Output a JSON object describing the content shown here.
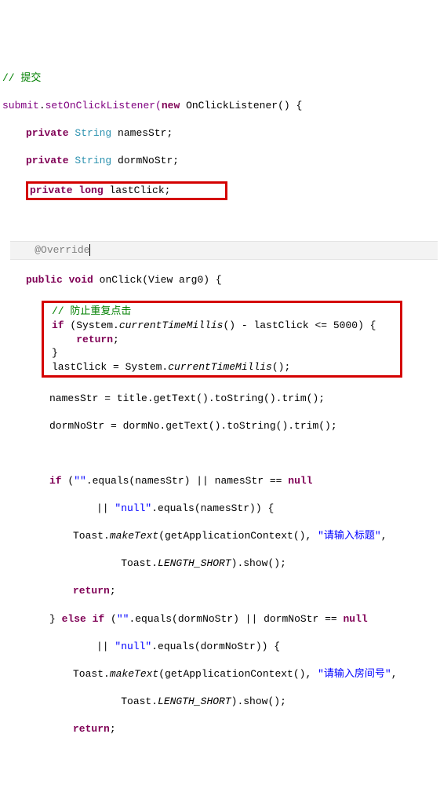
{
  "code": {
    "cmt_submit": "// 提交",
    "submit": "submit",
    "dot": ".",
    "setOnClickListener": "setOnClickListener(",
    "new": "new",
    "onClickListener": " OnClickListener() {",
    "private": "private",
    "string": "String",
    "long": "long",
    "namesStr_decl": " namesStr;",
    "dormNoStr_decl": " dormNoStr;",
    "lastClick_decl": " lastClick;",
    "override": "@Override",
    "public": "public",
    "void": "void",
    "onClick_sig": " onClick(View arg0) {",
    "cmt_prevent": "// 防止重复点击",
    "if": "if",
    "sys1a": " (System.",
    "ctm": "currentTimeMillis",
    "sys1b": "() - lastClick <= 5000) {",
    "return": "return",
    "semi": ";",
    "rbrace": "}",
    "lastclick_a": "lastClick = System.",
    "lastclick_b": "();",
    "names_a": "namesStr = title.getText().toString().trim();",
    "dorm_a": "dormNoStr = dormNo.getText().toString().trim();",
    "if2a": " (",
    "emptystr": "\"\"",
    "if2b": ".equals(namesStr) || namesStr == ",
    "null": "null",
    "or_a": "|| ",
    "nullstr": "\"null\"",
    "or_b": ".equals(namesStr)) {",
    "toast_a": "Toast.",
    "makeText": "makeText",
    "toast_b": "(getApplicationContext(), ",
    "str_title": "\"请输入标题\"",
    "comma": ",",
    "toast_c": "Toast.",
    "length_short": "LENGTH_SHORT",
    "toast_d": ").show();",
    "else_if": "else if",
    "elseif_a": " (",
    "elseif_b": ".equals(dormNoStr) || dormNoStr == ",
    "or_c": ".equals(dormNoStr)) {",
    "str_room": "\"请输入房间号\""
  }
}
